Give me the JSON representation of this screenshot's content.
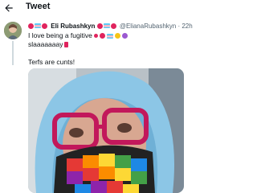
{
  "header": {
    "title": "Tweet"
  },
  "tweet": {
    "author_name": "Eli Rubashkyn",
    "author_handle": "@ElianaRubashkyn",
    "separator": "·",
    "time": "22h",
    "text_lines": [
      "I love being a fugitive",
      "slaaaaaaay",
      "Terfs are cunts!"
    ],
    "emoji": [
      "heart-emoji",
      "trans-flag-emoji",
      "heart-emoji",
      "nail-polish-emoji",
      "yellow-heart-emoji",
      "purple-heart-emoji"
    ]
  },
  "colors": {
    "red": "#e0245e",
    "link_gray": "#536471",
    "trans_blue": "#5bcefa",
    "trans_pink": "#f5a9b8",
    "hoodie": "#8cc6e6",
    "glasses": "#c2185b"
  }
}
